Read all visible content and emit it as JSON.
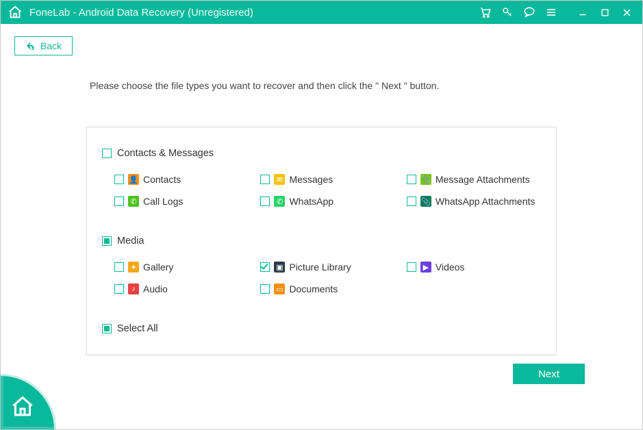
{
  "titlebar": {
    "title": "FoneLab - Android Data Recovery (Unregistered)"
  },
  "back_label": "Back",
  "instruction": "Please choose the file types you want to recover and then click the \" Next \" button.",
  "sections": {
    "contacts_messages": {
      "header": "Contacts & Messages",
      "header_state": "unchecked",
      "items": [
        {
          "label": "Contacts",
          "state": "unchecked",
          "icon_bg": "#f39013",
          "glyph": "👤"
        },
        {
          "label": "Messages",
          "state": "unchecked",
          "icon_bg": "#f6c21b",
          "glyph": "✉"
        },
        {
          "label": "Message Attachments",
          "state": "unchecked",
          "icon_bg": "#7bc21e",
          "glyph": "📎"
        },
        {
          "label": "Call Logs",
          "state": "unchecked",
          "icon_bg": "#4cc21e",
          "glyph": "✆"
        },
        {
          "label": "WhatsApp",
          "state": "unchecked",
          "icon_bg": "#25d366",
          "glyph": "✆"
        },
        {
          "label": "WhatsApp Attachments",
          "state": "unchecked",
          "icon_bg": "#0d7b5e",
          "glyph": "📎"
        }
      ]
    },
    "media": {
      "header": "Media",
      "header_state": "partial",
      "items": [
        {
          "label": "Gallery",
          "state": "unchecked",
          "icon_bg": "#f6a71b",
          "glyph": "✦"
        },
        {
          "label": "Picture Library",
          "state": "checked",
          "icon_bg": "#2b3a4a",
          "glyph": "▣"
        },
        {
          "label": "Videos",
          "state": "unchecked",
          "icon_bg": "#6a3fe0",
          "glyph": "▶"
        },
        {
          "label": "Audio",
          "state": "unchecked",
          "icon_bg": "#e54141",
          "glyph": "♪"
        },
        {
          "label": "Documents",
          "state": "unchecked",
          "icon_bg": "#f39013",
          "glyph": "▭"
        }
      ]
    },
    "select_all": {
      "label": "Select All",
      "state": "partial"
    }
  },
  "next_label": "Next"
}
